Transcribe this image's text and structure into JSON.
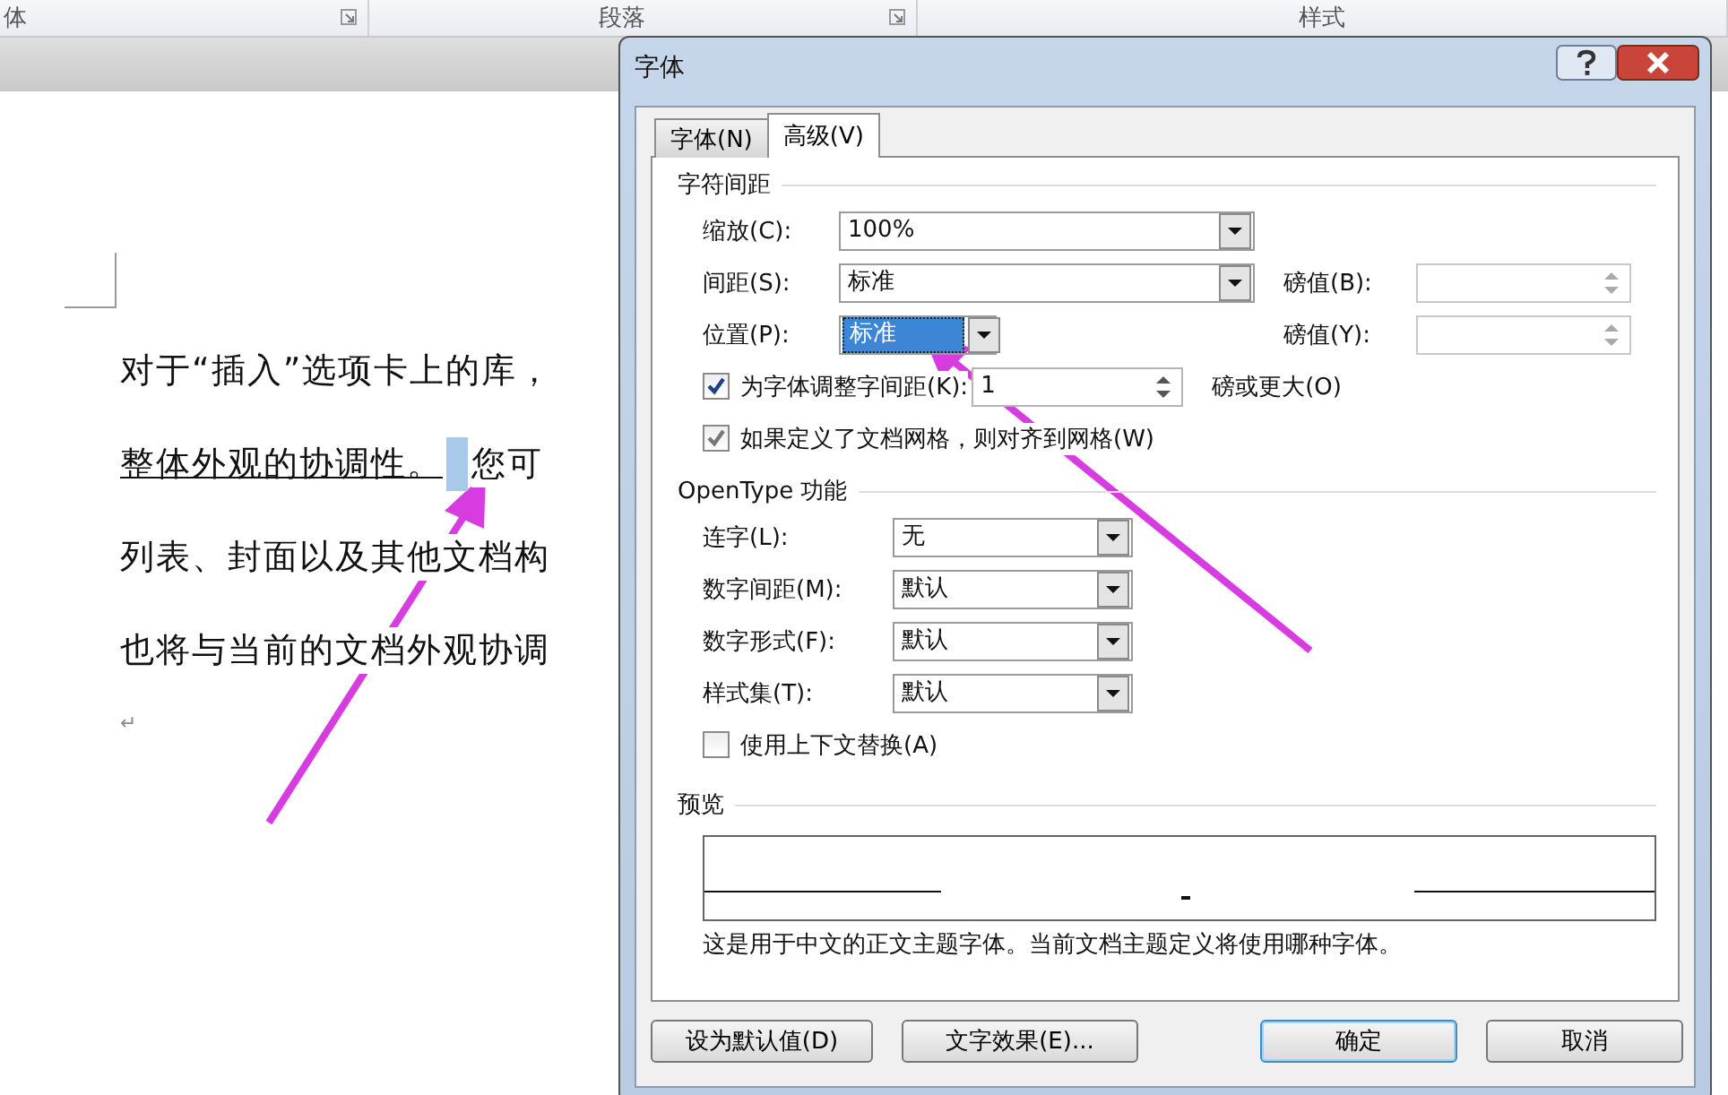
{
  "ribbon_groups": [
    {
      "label": "体"
    },
    {
      "label": "段落"
    },
    {
      "label": "样式"
    }
  ],
  "document": {
    "lines": [
      {
        "text": "对于“插入”选项卡上的库，"
      },
      {
        "text": "整体外观的协调性。",
        "underlined": true,
        "selection": true,
        "tail": "您可"
      },
      {
        "text": "列表、封面以及其他文档构"
      },
      {
        "text": "也将与当前的文档外观协调"
      }
    ],
    "paragraph_mark": "↵"
  },
  "dialog": {
    "title": "字体",
    "tabs": [
      {
        "label": "字体(N)",
        "selected": false
      },
      {
        "label": "高级(V)",
        "selected": true
      }
    ],
    "character_spacing": {
      "title": "字符间距",
      "fields": [
        {
          "kind": "wide",
          "label": "缩放(C):",
          "value": "100%",
          "highlighted": false
        },
        {
          "kind": "wide",
          "label": "间距(S):",
          "value": "标准",
          "highlighted": false,
          "by_label": "磅值(B):"
        },
        {
          "kind": "narrow",
          "label": "位置(P):",
          "value": "标准",
          "highlighted": true,
          "by_label": "磅值(Y):"
        }
      ],
      "kerning": {
        "label": "为字体调整字间距(K):",
        "checked": true,
        "value": "1",
        "suffix": "磅或更大(O)"
      },
      "grid": {
        "label": "如果定义了文档网格，则对齐到网格(W)",
        "checked": true
      }
    },
    "opentype": {
      "title": "OpenType 功能",
      "selects": [
        {
          "label": "连字(L):",
          "value": "无"
        },
        {
          "label": "数字间距(M):",
          "value": "默认"
        },
        {
          "label": "数字形式(F):",
          "value": "默认"
        },
        {
          "label": "样式集(T):",
          "value": "默认"
        }
      ],
      "contextual": {
        "label": "使用上下文替换(A)",
        "checked": false
      }
    },
    "preview": {
      "title": "预览",
      "note": "这是用于中文的正文主题字体。当前文档主题定义将使用哪种字体。"
    },
    "buttons": [
      {
        "label": "设为默认值(D)",
        "default": false
      },
      {
        "label": "文字效果(E)...",
        "default": false
      },
      {
        "label": "确定",
        "default": true
      },
      {
        "label": "取消",
        "default": false
      }
    ]
  }
}
